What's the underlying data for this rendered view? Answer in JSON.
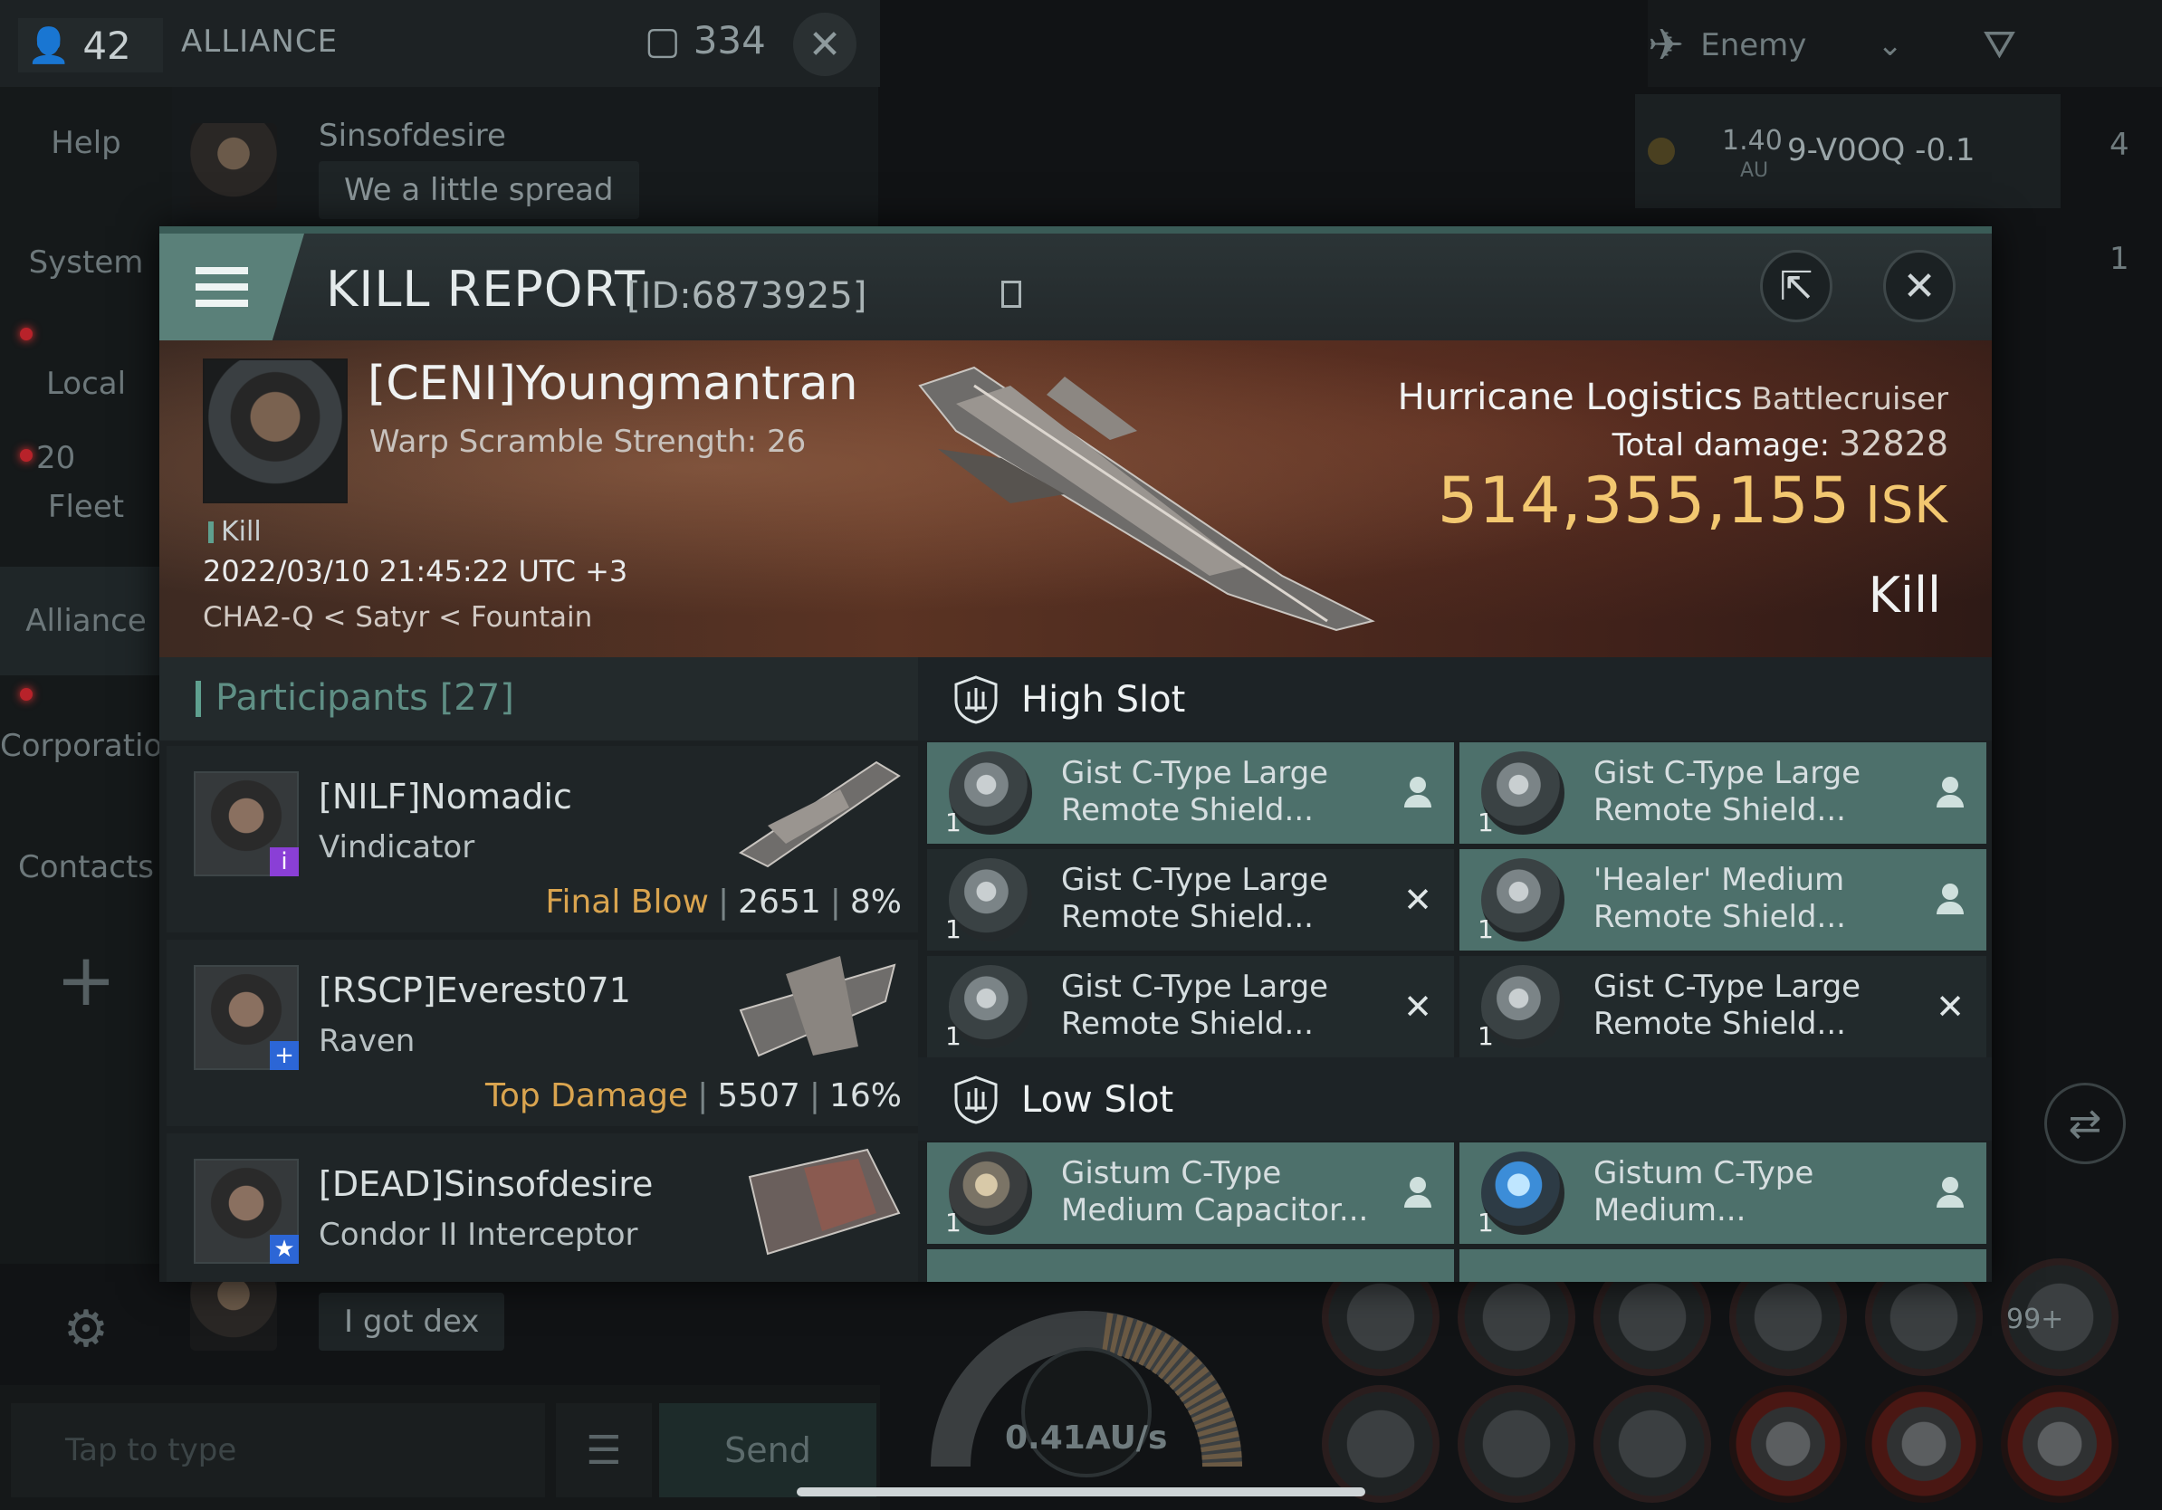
{
  "background": {
    "chat": {
      "member_count": "42",
      "channel": "ALLIANCE",
      "message_count": "334",
      "tabs": [
        "Help",
        "System",
        "Local",
        "Fleet",
        "Alliance",
        "Corporation",
        "Contacts"
      ],
      "local_count": "20",
      "messages": [
        {
          "sender": "Sinsofdesire",
          "text": "We a little spread"
        },
        {
          "sender": "",
          "text": "I got dex"
        }
      ],
      "input_placeholder": "Tap to type",
      "send_label": "Send"
    },
    "overview": {
      "filter_label": "Enemy",
      "entry": {
        "distance": "1.40",
        "unit": "AU",
        "name": "9-V0OQ -0.1"
      },
      "side_counts": [
        "4",
        "1"
      ]
    },
    "hud": {
      "speed": "0.41AU/s",
      "module_badge": "99+"
    }
  },
  "kill_report": {
    "title": "KILL REPORT",
    "report_id": "[ID:6873925]",
    "victim": {
      "name": "[CENI]Youngmantran",
      "warp_scramble": "Warp Scramble Strength: 26",
      "kill_tag": "Kill",
      "datetime": "2022/03/10 21:45:22 UTC +3",
      "location": "CHA2-Q < Satyr < Fountain"
    },
    "ship": {
      "name": "Hurricane Logistics",
      "class": "Battlecruiser",
      "total_damage_label": "Total damage:",
      "total_damage": "32828",
      "isk_value": "514,355,155",
      "isk_unit": "ISK",
      "result": "Kill"
    },
    "participants": {
      "label": "Participants",
      "count": "[27]",
      "rows": [
        {
          "name": "[NILF]Nomadic",
          "ship": "Vindicator",
          "tag": "Final Blow",
          "damage": "2651",
          "percent": "8%",
          "badge": "i",
          "badge_color": "#8a3fd6"
        },
        {
          "name": "[RSCP]Everest071",
          "ship": "Raven",
          "tag": "Top Damage",
          "damage": "5507",
          "percent": "16%",
          "badge": "+",
          "badge_color": "#2c66d6"
        },
        {
          "name": "[DEAD]Sinsofdesire",
          "ship": "Condor II Interceptor",
          "tag": "",
          "damage": "",
          "percent": "",
          "badge": "★",
          "badge_color": "#2c66d6"
        }
      ]
    },
    "high_slot": {
      "label": "High Slot",
      "items": [
        {
          "qty": "1",
          "name": "Gist C-Type Large Remote Shield...",
          "status": "person",
          "active": true
        },
        {
          "qty": "1",
          "name": "Gist C-Type Large Remote Shield...",
          "status": "person",
          "active": true
        },
        {
          "qty": "1",
          "name": "Gist C-Type Large Remote Shield...",
          "status": "x",
          "active": false
        },
        {
          "qty": "1",
          "name": "'Healer' Medium Remote Shield...",
          "status": "person",
          "active": true
        },
        {
          "qty": "1",
          "name": "Gist C-Type Large Remote Shield...",
          "status": "x",
          "active": false
        },
        {
          "qty": "1",
          "name": "Gist C-Type Large Remote Shield...",
          "status": "x",
          "active": false
        }
      ]
    },
    "low_slot": {
      "label": "Low Slot",
      "items": [
        {
          "qty": "1",
          "name": "Gistum C-Type Medium Capacitor...",
          "status": "person",
          "active": true
        },
        {
          "qty": "1",
          "name": "Gistum C-Type Medium...",
          "status": "person",
          "active": true
        }
      ]
    }
  }
}
